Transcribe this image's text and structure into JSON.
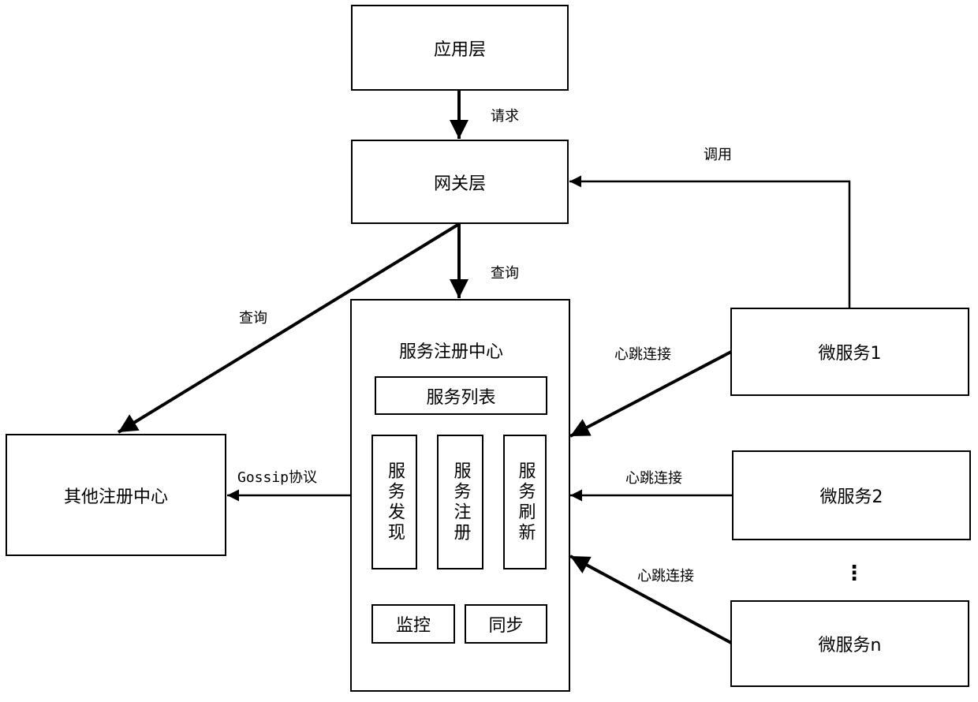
{
  "nodes": {
    "app_layer": "应用层",
    "gateway_layer": "网关层",
    "registry": {
      "title": "服务注册中心",
      "service_list": "服务列表",
      "discovery": "服务发现",
      "register": "服务注册",
      "refresh": "服务刷新",
      "monitor": "监控",
      "sync": "同步"
    },
    "other_registry": "其他注册中心",
    "microservice_1": "微服务1",
    "microservice_2": "微服务2",
    "microservice_n": "微服务n",
    "ellipsis": "⋮"
  },
  "edges": {
    "request": "请求",
    "query_registry": "查询",
    "query_other": "查询",
    "invoke": "调用",
    "gossip": "Gossip协议",
    "heartbeat_1": "心跳连接",
    "heartbeat_2": "心跳连接",
    "heartbeat_n": "心跳连接"
  }
}
